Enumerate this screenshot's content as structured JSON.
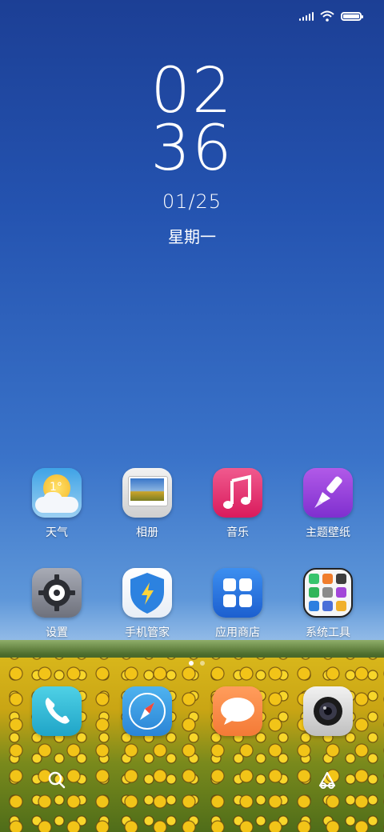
{
  "status_bar": {
    "signal": "signal-bars-icon",
    "wifi": "wifi-icon",
    "battery_level": 1.0
  },
  "lockscreen": {
    "hour": "02",
    "minute": "36",
    "date": "01/25",
    "weekday": "星期一"
  },
  "apps_row1": [
    {
      "label": "天气",
      "temp": "1°"
    },
    {
      "label": "相册"
    },
    {
      "label": "音乐"
    },
    {
      "label": "主题壁纸"
    }
  ],
  "apps_row2": [
    {
      "label": "设置"
    },
    {
      "label": "手机管家"
    },
    {
      "label": "应用商店"
    },
    {
      "label": "系统工具"
    }
  ],
  "dock": [
    "phone-icon",
    "browser-icon",
    "messages-icon",
    "camera-icon"
  ],
  "page_indicator": {
    "pages": 2,
    "current": 1
  },
  "bottom_bar": [
    "search-icon",
    "app-drawer-icon"
  ]
}
